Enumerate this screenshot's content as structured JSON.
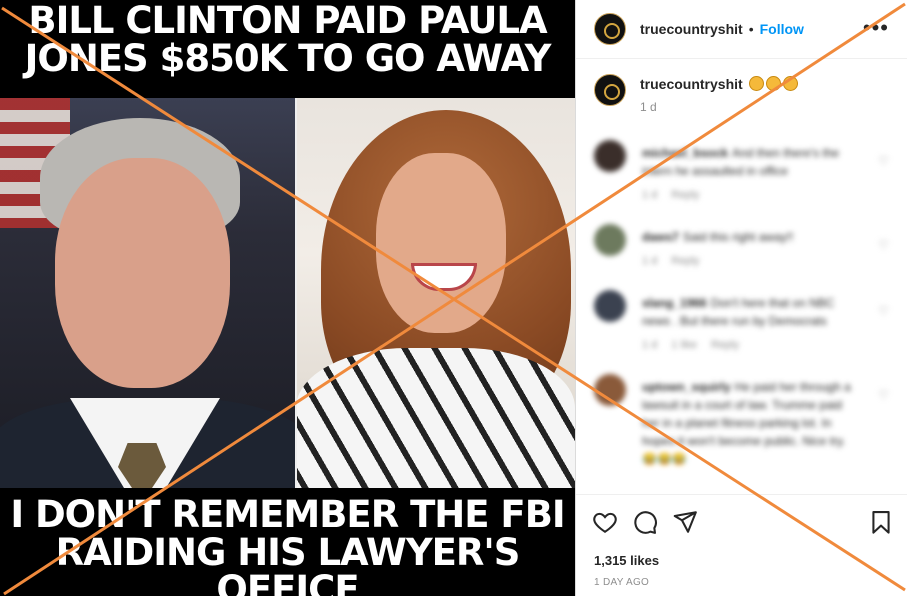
{
  "meme": {
    "top_text": "BILL CLINTON PAID PAULA JONES $850K TO GO AWAY",
    "bottom_text": "I DON'T REMEMBER THE FBI RAIDING HIS LAWYER'S OFFICE"
  },
  "header": {
    "username": "truecountryshit",
    "separator": "•",
    "follow_label": "Follow",
    "more_label": "•••"
  },
  "caption": {
    "username": "truecountryshit",
    "emojis": [
      "thinking-emoji",
      "thinking-emoji",
      "thinking-emoji"
    ],
    "time": "1 d"
  },
  "comments": [
    {
      "user": "michael_bsock",
      "text": "And then there's the intern he assaulted in office",
      "time": "1 d",
      "reply": "Reply",
      "avatar_color": "#3a2e2a"
    },
    {
      "user": "daws7",
      "text": "Said this right away!!",
      "time": "1 d",
      "reply": "Reply",
      "avatar_color": "#6d7a5e"
    },
    {
      "user": "slang_1966",
      "text": "Don't here that on NBC news . But there run by Democrats",
      "time": "1 d",
      "likes": "1 like",
      "reply": "Reply",
      "avatar_color": "#3b4250"
    },
    {
      "user": "uptown_squirly",
      "text": "He paid her through a lawsuit in a court of law. Trumme paid her in a planet fitness parking lot. In hopes it won't become public. Nice try. 😂😂😂",
      "time": "",
      "reply": "",
      "avatar_color": "#8a5a3a"
    }
  ],
  "footer": {
    "likes": "1,315 likes",
    "time_ago": "1 DAY AGO"
  },
  "colors": {
    "link_blue": "#0095f6",
    "overlay_orange": "#f08a3c",
    "muted_gray": "#8e8e8e"
  },
  "icons": {
    "like": "heart-icon",
    "comment": "comment-icon",
    "share": "share-icon",
    "save": "bookmark-icon"
  }
}
